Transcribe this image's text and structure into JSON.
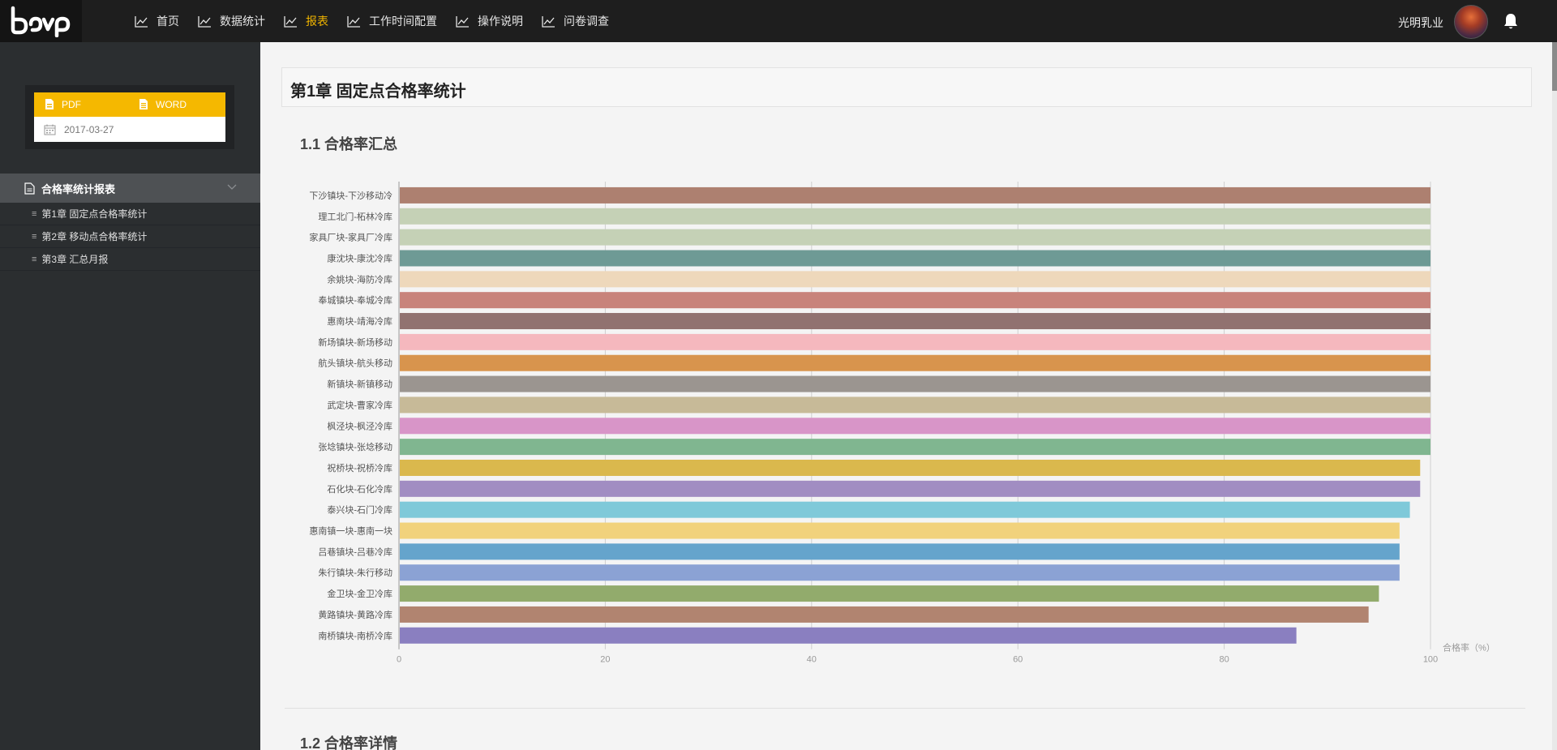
{
  "app": {
    "logo_text": "beep"
  },
  "nav": {
    "items": [
      {
        "label": "首页",
        "active": false,
        "name": "nav-home"
      },
      {
        "label": "数据统计",
        "active": false,
        "name": "nav-data-stats"
      },
      {
        "label": "报表",
        "active": true,
        "name": "nav-reports"
      },
      {
        "label": "工作时间配置",
        "active": false,
        "name": "nav-worktime-config"
      },
      {
        "label": "操作说明",
        "active": false,
        "name": "nav-instructions"
      },
      {
        "label": "问卷调查",
        "active": false,
        "name": "nav-survey"
      }
    ]
  },
  "user": {
    "name": "光明乳业"
  },
  "sidebar": {
    "export_pdf": "PDF",
    "export_word": "WORD",
    "date": "2017-03-27",
    "menu_head": "合格率统计报表",
    "sub_items": [
      {
        "label": "第1章 固定点合格率统计"
      },
      {
        "label": "第2章 移动点合格率统计"
      },
      {
        "label": "第3章 汇总月报"
      }
    ]
  },
  "main": {
    "chapter_title": "第1章 固定点合格率统计",
    "section1_title": "1.1 合格率汇总",
    "section2_title": "1.2 合格率详情"
  },
  "colors": {
    "accent": "#f0b400",
    "topbar": "#1e1e1e",
    "sidebar": "#2b2e30"
  },
  "chart_data": {
    "type": "bar",
    "orientation": "horizontal",
    "categories": [
      "下沙镇块-下沙移动冷",
      "理工北门-柘林冷库",
      "家具厂块-家具厂冷库",
      "康沈块-康沈冷库",
      "余姚块-海防冷库",
      "奉城镇块-奉城冷库",
      "惠南块-靖海冷库",
      "新场镇块-新场移动",
      "航头镇块-航头移动",
      "新镇块-新镇移动",
      "武定块-曹家冷库",
      "枫泾块-枫泾冷库",
      "张埝镇块-张埝移动",
      "祝桥块-祝桥冷库",
      "石化块-石化冷库",
      "泰兴块-石门冷库",
      "惠南镇一块-惠南一块",
      "吕巷镇块-吕巷冷库",
      "朱行镇块-朱行移动",
      "金卫块-金卫冷库",
      "黄路镇块-黄路冷库",
      "南桥镇块-南桥冷库"
    ],
    "values": [
      100,
      100,
      100,
      100,
      100,
      100,
      100,
      100,
      100,
      100,
      100,
      100,
      100,
      99,
      99,
      98,
      97,
      97,
      97,
      95,
      94,
      87
    ],
    "colors": [
      "#ad8070",
      "#c5d1b6",
      "#c5d1b6",
      "#6e9a95",
      "#eed8bb",
      "#c8837b",
      "#917270",
      "#f5b8be",
      "#d8944d",
      "#9b9590",
      "#c7ba98",
      "#d895c8",
      "#80b690",
      "#dab84d",
      "#a18dc2",
      "#7fc9d9",
      "#f1d27c",
      "#65a4cc",
      "#8ba2d4",
      "#92ab6c",
      "#b18470",
      "#8a7fc0"
    ],
    "xlim": [
      0,
      100
    ],
    "xticks": [
      "0",
      "20",
      "40",
      "60",
      "80",
      "100"
    ],
    "xlabel": "合格率（%）",
    "grid": true
  }
}
